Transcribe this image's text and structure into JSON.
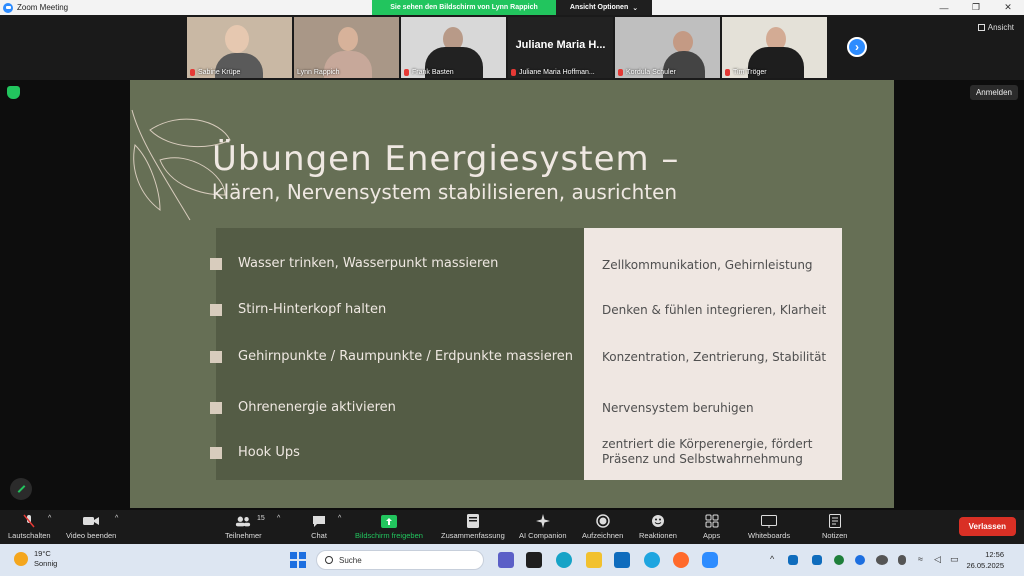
{
  "window": {
    "title": "Zoom Meeting",
    "controls": [
      "—",
      "❐",
      "✕"
    ]
  },
  "share_banner": {
    "notice": "Sie sehen den Bildschirm von Lynn Rappich",
    "options": "Ansicht Optionen"
  },
  "view_button": "Ansicht",
  "participants": [
    {
      "name": "Sabine Krüpe"
    },
    {
      "name": "Lynn Rappich"
    },
    {
      "name": "Frank Basten"
    },
    {
      "name": "Juliane Maria Hoffman...",
      "display": "Juliane Maria H..."
    },
    {
      "name": "Kordula Schuler"
    },
    {
      "name": "Tim Tröger"
    }
  ],
  "anmelden": "Anmelden",
  "slide": {
    "title": "Übungen Energiesystem –",
    "subtitle": "klären, Nervensystem stabilisieren, ausrichten",
    "left_items": [
      "Wasser trinken, Wasserpunkt massieren",
      "Stirn-Hinterkopf halten",
      "Gehirnpunkte / Raumpunkte / Erdpunkte massieren",
      "Ohrenenergie aktivieren",
      "Hook Ups"
    ],
    "right_items": [
      "Zellkommunikation, Gehirnleistung",
      "Denken & fühlen integrieren, Klarheit",
      "Konzentration, Zentrierung, Stabilität",
      "Nervensystem beruhigen",
      "zentriert die Körperenergie, fördert Präsenz und Selbstwahrnehmung"
    ]
  },
  "toolbar": {
    "mute": "Lautschalten",
    "video": "Video beenden",
    "participants": "Teilnehmer",
    "participants_count": "15",
    "chat": "Chat",
    "share": "Bildschirm freigeben",
    "summary": "Zusammenfassung",
    "ai": "AI Companion",
    "record": "Aufzeichnen",
    "reactions": "Reaktionen",
    "apps": "Apps",
    "whiteboards": "Whiteboards",
    "notes": "Notizen",
    "leave": "Verlassen"
  },
  "taskbar": {
    "temp": "19°C",
    "weather": "Sonnig",
    "search_placeholder": "Suche",
    "time": "12:56",
    "date": "26.05.2025"
  }
}
